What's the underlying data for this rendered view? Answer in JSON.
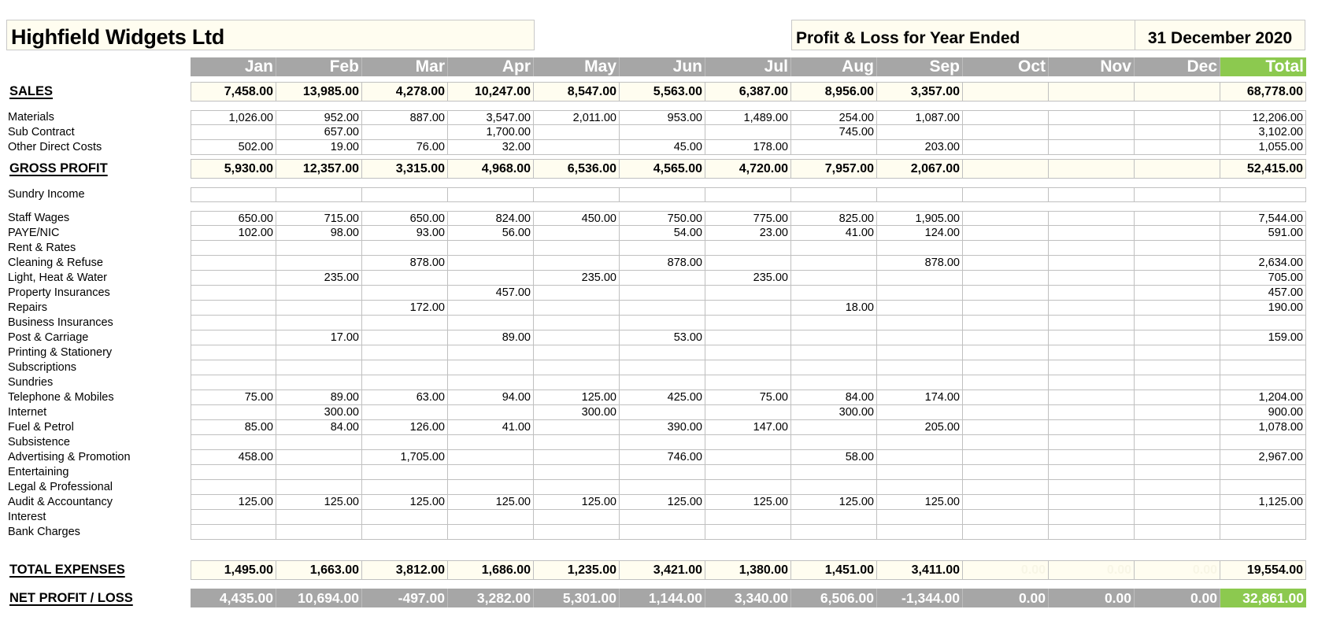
{
  "header": {
    "company": "Highfield Widgets Ltd",
    "report_title": "Profit & Loss for Year Ended",
    "report_date": "31 December 2020"
  },
  "columns": [
    "Jan",
    "Feb",
    "Mar",
    "Apr",
    "May",
    "Jun",
    "Jul",
    "Aug",
    "Sep",
    "Oct",
    "Nov",
    "Dec",
    "Total"
  ],
  "colors": {
    "header_grey": "#a6a6a6",
    "total_green": "#8cc94f",
    "cell_cream": "#fffdf0",
    "grid_line": "#c0c0c0"
  },
  "sales": {
    "label": "SALES",
    "values": [
      "7,458.00",
      "13,985.00",
      "4,278.00",
      "10,247.00",
      "8,547.00",
      "5,563.00",
      "6,387.00",
      "8,956.00",
      "3,357.00",
      "",
      "",
      "",
      "68,778.00"
    ]
  },
  "direct_costs": [
    {
      "label": "Materials",
      "values": [
        "1,026.00",
        "952.00",
        "887.00",
        "3,547.00",
        "2,011.00",
        "953.00",
        "1,489.00",
        "254.00",
        "1,087.00",
        "",
        "",
        "",
        "12,206.00"
      ]
    },
    {
      "label": "Sub Contract",
      "values": [
        "",
        "657.00",
        "",
        "1,700.00",
        "",
        "",
        "",
        "745.00",
        "",
        "",
        "",
        "",
        "3,102.00"
      ]
    },
    {
      "label": "Other Direct Costs",
      "values": [
        "502.00",
        "19.00",
        "76.00",
        "32.00",
        "",
        "45.00",
        "178.00",
        "",
        "203.00",
        "",
        "",
        "",
        "1,055.00"
      ]
    }
  ],
  "gross_profit": {
    "label": "GROSS PROFIT",
    "values": [
      "5,930.00",
      "12,357.00",
      "3,315.00",
      "4,968.00",
      "6,536.00",
      "4,565.00",
      "4,720.00",
      "7,957.00",
      "2,067.00",
      "",
      "",
      "",
      "52,415.00"
    ]
  },
  "sundry_income": {
    "label": "Sundry Income",
    "values": [
      "",
      "",
      "",
      "",
      "",
      "",
      "",
      "",
      "",
      "",
      "",
      "",
      ""
    ]
  },
  "expenses": [
    {
      "label": "Staff Wages",
      "values": [
        "650.00",
        "715.00",
        "650.00",
        "824.00",
        "450.00",
        "750.00",
        "775.00",
        "825.00",
        "1,905.00",
        "",
        "",
        "",
        "7,544.00"
      ]
    },
    {
      "label": "PAYE/NIC",
      "values": [
        "102.00",
        "98.00",
        "93.00",
        "56.00",
        "",
        "54.00",
        "23.00",
        "41.00",
        "124.00",
        "",
        "",
        "",
        "591.00"
      ]
    },
    {
      "label": "Rent & Rates",
      "values": [
        "",
        "",
        "",
        "",
        "",
        "",
        "",
        "",
        "",
        "",
        "",
        "",
        ""
      ]
    },
    {
      "label": "Cleaning & Refuse",
      "values": [
        "",
        "",
        "878.00",
        "",
        "",
        "878.00",
        "",
        "",
        "878.00",
        "",
        "",
        "",
        "2,634.00"
      ]
    },
    {
      "label": "Light, Heat & Water",
      "values": [
        "",
        "235.00",
        "",
        "",
        "235.00",
        "",
        "235.00",
        "",
        "",
        "",
        "",
        "",
        "705.00"
      ]
    },
    {
      "label": "Property Insurances",
      "values": [
        "",
        "",
        "",
        "457.00",
        "",
        "",
        "",
        "",
        "",
        "",
        "",
        "",
        "457.00"
      ]
    },
    {
      "label": "Repairs",
      "values": [
        "",
        "",
        "172.00",
        "",
        "",
        "",
        "",
        "18.00",
        "",
        "",
        "",
        "",
        "190.00"
      ]
    },
    {
      "label": "Business Insurances",
      "values": [
        "",
        "",
        "",
        "",
        "",
        "",
        "",
        "",
        "",
        "",
        "",
        "",
        ""
      ]
    },
    {
      "label": "Post & Carriage",
      "values": [
        "",
        "17.00",
        "",
        "89.00",
        "",
        "53.00",
        "",
        "",
        "",
        "",
        "",
        "",
        "159.00"
      ]
    },
    {
      "label": "Printing & Stationery",
      "values": [
        "",
        "",
        "",
        "",
        "",
        "",
        "",
        "",
        "",
        "",
        "",
        "",
        ""
      ]
    },
    {
      "label": "Subscriptions",
      "values": [
        "",
        "",
        "",
        "",
        "",
        "",
        "",
        "",
        "",
        "",
        "",
        "",
        ""
      ]
    },
    {
      "label": "Sundries",
      "values": [
        "",
        "",
        "",
        "",
        "",
        "",
        "",
        "",
        "",
        "",
        "",
        "",
        ""
      ]
    },
    {
      "label": "Telephone & Mobiles",
      "values": [
        "75.00",
        "89.00",
        "63.00",
        "94.00",
        "125.00",
        "425.00",
        "75.00",
        "84.00",
        "174.00",
        "",
        "",
        "",
        "1,204.00"
      ]
    },
    {
      "label": "Internet",
      "values": [
        "",
        "300.00",
        "",
        "",
        "300.00",
        "",
        "",
        "300.00",
        "",
        "",
        "",
        "",
        "900.00"
      ]
    },
    {
      "label": "Fuel & Petrol",
      "values": [
        "85.00",
        "84.00",
        "126.00",
        "41.00",
        "",
        "390.00",
        "147.00",
        "",
        "205.00",
        "",
        "",
        "",
        "1,078.00"
      ]
    },
    {
      "label": "Subsistence",
      "values": [
        "",
        "",
        "",
        "",
        "",
        "",
        "",
        "",
        "",
        "",
        "",
        "",
        ""
      ]
    },
    {
      "label": "Advertising & Promotion",
      "values": [
        "458.00",
        "",
        "1,705.00",
        "",
        "",
        "746.00",
        "",
        "58.00",
        "",
        "",
        "",
        "",
        "2,967.00"
      ]
    },
    {
      "label": "Entertaining",
      "values": [
        "",
        "",
        "",
        "",
        "",
        "",
        "",
        "",
        "",
        "",
        "",
        "",
        ""
      ]
    },
    {
      "label": "Legal & Professional",
      "values": [
        "",
        "",
        "",
        "",
        "",
        "",
        "",
        "",
        "",
        "",
        "",
        "",
        ""
      ]
    },
    {
      "label": "Audit & Accountancy",
      "values": [
        "125.00",
        "125.00",
        "125.00",
        "125.00",
        "125.00",
        "125.00",
        "125.00",
        "125.00",
        "125.00",
        "",
        "",
        "",
        "1,125.00"
      ]
    },
    {
      "label": "Interest",
      "values": [
        "",
        "",
        "",
        "",
        "",
        "",
        "",
        "",
        "",
        "",
        "",
        "",
        ""
      ]
    },
    {
      "label": "Bank Charges",
      "values": [
        "",
        "",
        "",
        "",
        "",
        "",
        "",
        "",
        "",
        "",
        "",
        "",
        ""
      ]
    }
  ],
  "total_expenses": {
    "label": "TOTAL EXPENSES",
    "values": [
      "1,495.00",
      "1,663.00",
      "3,812.00",
      "1,686.00",
      "1,235.00",
      "3,421.00",
      "1,380.00",
      "1,451.00",
      "3,411.00",
      "0.00",
      "0.00",
      "0.00",
      "19,554.00"
    ],
    "faint_columns": [
      9,
      10,
      11
    ]
  },
  "net_profit": {
    "label": "NET PROFIT / LOSS",
    "values": [
      "4,435.00",
      "10,694.00",
      "-497.00",
      "3,282.00",
      "5,301.00",
      "1,144.00",
      "3,340.00",
      "6,506.00",
      "-1,344.00",
      "0.00",
      "0.00",
      "0.00",
      "32,861.00"
    ]
  }
}
